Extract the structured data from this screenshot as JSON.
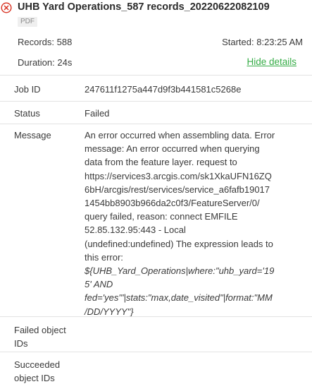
{
  "job": {
    "status_icon": "error-circle-x-icon",
    "title": "UHB Yard Operations_587 records_20220622082109",
    "format_badge": "PDF",
    "records_text": "Records: 588",
    "started_text": "Started: 8:23:25 AM",
    "duration_text": "Duration: 24s",
    "hide_details_label": "Hide details"
  },
  "details": {
    "job_id": {
      "label": "Job ID",
      "value": "247611f1275a447d9f3b441581c5268e"
    },
    "status": {
      "label": "Status",
      "value": "Failed"
    },
    "message": {
      "label": "Message",
      "lines": [
        "An error occurred when assembling data. Error",
        "message: An error occurred when querying",
        "data from the feature layer. request to",
        "https://services3.arcgis.com/sk1XkaUFN16ZQ",
        "6bH/arcgis/rest/services/service_a6fafb19017",
        "1454bb8903b966da2c0f3/FeatureServer/0/",
        "query failed, reason: connect EMFILE",
        "52.85.132.95:443 - Local",
        "(undefined:undefined) The expression leads to",
        "this error:"
      ],
      "expression_lines": [
        "${UHB_Yard_Operations|where:\"uhb_yard='19",
        "5' AND",
        "fed='yes'\"|stats:\"max,date_visited\"|format:\"MM",
        "/DD/YYYY\"}"
      ]
    },
    "failed_ids": {
      "label": "Failed object IDs",
      "value": ""
    },
    "succeeded_ids": {
      "label": "Succeeded object IDs",
      "value": ""
    }
  },
  "colors": {
    "error_icon": "#d83020",
    "link": "#35ac46",
    "divider": "#e3e3e3",
    "badge_bg": "#efefef"
  }
}
